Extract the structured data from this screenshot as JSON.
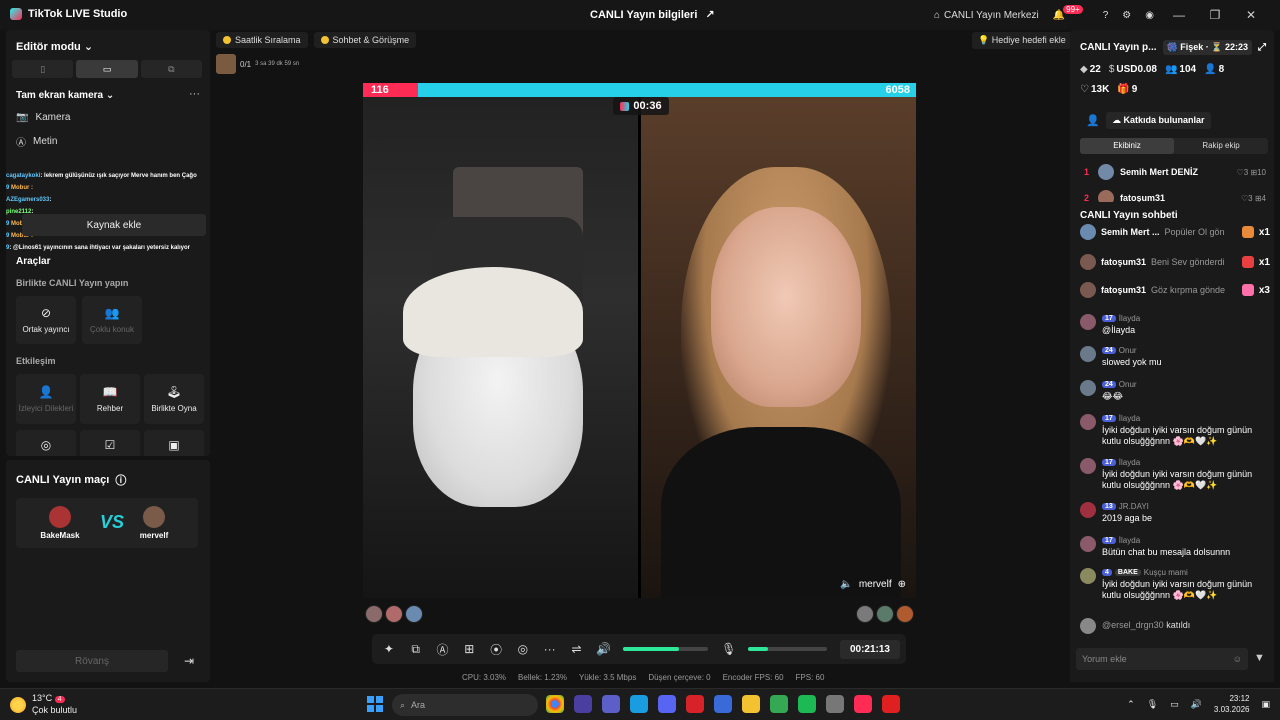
{
  "titlebar": {
    "app_name": "TikTok LIVE Studio",
    "center_title": "CANLI Yayın bilgileri",
    "live_center": "CANLI Yayın Merkezi",
    "notif_badge": "99+"
  },
  "left": {
    "editor_mode": "Editör modu",
    "camera_section": "Tam ekran kamera",
    "items": [
      {
        "label": "Kamera",
        "icon": "camera-icon"
      },
      {
        "label": "Metin",
        "icon": "text-icon"
      }
    ],
    "chat_overlay": [
      {
        "name": "cagataykoki",
        "text": ": lekrem gülüşünüz ışık saçıyor Merve hanım ben Çağo"
      },
      {
        "name": "9",
        "mob": "Mobur :",
        "text": ""
      },
      {
        "name": "AZEgamers033",
        "text": ":"
      },
      {
        "name": "pine2112",
        "text": ":"
      },
      {
        "name": "9",
        "mob": "Mobur :",
        "text": ""
      },
      {
        "name": "9",
        "mob": "Mobur :",
        "text": ""
      },
      {
        "name": "9",
        "text": ": @Linos61 yayıncının sana ihtiyacı var şakaları yetersiz kalıyor"
      }
    ],
    "add_source": "Kaynak ekle",
    "tools": "Araçlar",
    "together_section": "Birlikte CANLI Yayın yapın",
    "together_tiles": [
      {
        "label": "Ortak yayıncı",
        "dim": false
      },
      {
        "label": "Çoklu konuk",
        "dim": true
      }
    ],
    "interaction_section": "Etkileşim",
    "interaction_tiles": [
      {
        "label": "İzleyici Dilekleri",
        "dim": true
      },
      {
        "label": "Rehber",
        "dim": false
      },
      {
        "label": "Birlikte Oyna",
        "dim": false
      }
    ]
  },
  "match": {
    "title": "CANLI Yayın maçı",
    "left_user": "BakeMask",
    "right_user": "mervelf",
    "vs": "VS",
    "rematch": "Rövanş"
  },
  "pills": {
    "hourly": "Saatlik Sıralama",
    "chat_meet": "Sohbet & Görüşme",
    "goal_count": "0/1",
    "goal_time": "3 sa 39 dk 59 sn",
    "gift_goal": "Hediye hedefi ekle"
  },
  "stage": {
    "score_left": "116",
    "score_right": "6058",
    "score_left_fraction": 0.1,
    "timer": "00:36",
    "right_name": "mervelf"
  },
  "controls": {
    "elapsed": "00:21:13",
    "volume_fraction": 0.66,
    "mic_fraction": 0.25
  },
  "stats": {
    "cpu": "CPU: 3.03%",
    "memory": "Bellek: 1.23%",
    "upload": "Yükle: 3.5 Mbps",
    "dropped": "Düşen çerçeve: 0",
    "encoder": "Encoder FPS: 60",
    "fps": "FPS: 60"
  },
  "right": {
    "stream_title": "CANLI Yayın p...",
    "fisek": "Fişek ·",
    "fisek_time": "22:23",
    "stats1": {
      "coins": "22",
      "usd": "USD0.08",
      "viewers": "104",
      "live": "8"
    },
    "stats2": {
      "likes": "13K",
      "gifts": "9"
    },
    "contributors": "Katkıda bulunanlar",
    "tab_ours": "Ekibiniz",
    "tab_rival": "Rakip ekip",
    "ranks": [
      {
        "n": "1",
        "name": "Semih Mert DENİZ",
        "meta": "♡3  ⊞10"
      },
      {
        "n": "2",
        "name": "fatoşum31",
        "meta": "♡3  ⊞4"
      }
    ]
  },
  "chat": {
    "title": "CANLI Yayın sohbeti",
    "pinned": [
      {
        "name": "Semih Mert ...",
        "text": "Popüler Ol gön",
        "x": "x1",
        "color": "#e88a3a"
      },
      {
        "name": "fatoşum31",
        "text": "Beni Sev gönderdi",
        "x": "x1",
        "color": "#e84040"
      },
      {
        "name": "fatoşum31",
        "text": "Göz kırpma gönde",
        "x": "x3",
        "color": "#ff6fa8"
      }
    ],
    "messages": [
      {
        "lvl": "17",
        "user": "İlayda",
        "text": "@İlayda"
      },
      {
        "lvl": "24",
        "user": "Onur",
        "text": "slowed yok mu"
      },
      {
        "lvl": "24",
        "user": "Onur",
        "text": "😂😂"
      },
      {
        "lvl": "17",
        "user": "İlayda",
        "text": "İyiki doğdun iyiki varsın doğum günün kutlu olsuğğğnnn 🌸🫶🤍✨"
      },
      {
        "lvl": "17",
        "user": "İlayda",
        "text": "İyiki doğdun iyiki varsın doğum günün kutlu olsuğğğnnn 🌸🫶🤍✨"
      },
      {
        "lvl": "13",
        "user": "JR.DAYI",
        "text": "2019 aga be"
      },
      {
        "lvl": "17",
        "user": "İlayda",
        "text": "Bütün chat bu mesajla dolsunnn"
      },
      {
        "lvl": "4",
        "badge": "BAKE",
        "user": "Kuşçu mami",
        "text": "İyiki doğdun iyiki varsın doğum günün kutlu olsuğğğnnn 🌸🫶🤍✨"
      }
    ],
    "joined_user": "@ersel_drgn30",
    "joined_text": "katıldı",
    "placeholder": "Yorum ekle"
  },
  "taskbar": {
    "temp": "13°C",
    "weather": "Çok bulutlu",
    "weather_badge": "4",
    "search": "Ara",
    "time": "23:12",
    "date": "3.03.2026"
  }
}
